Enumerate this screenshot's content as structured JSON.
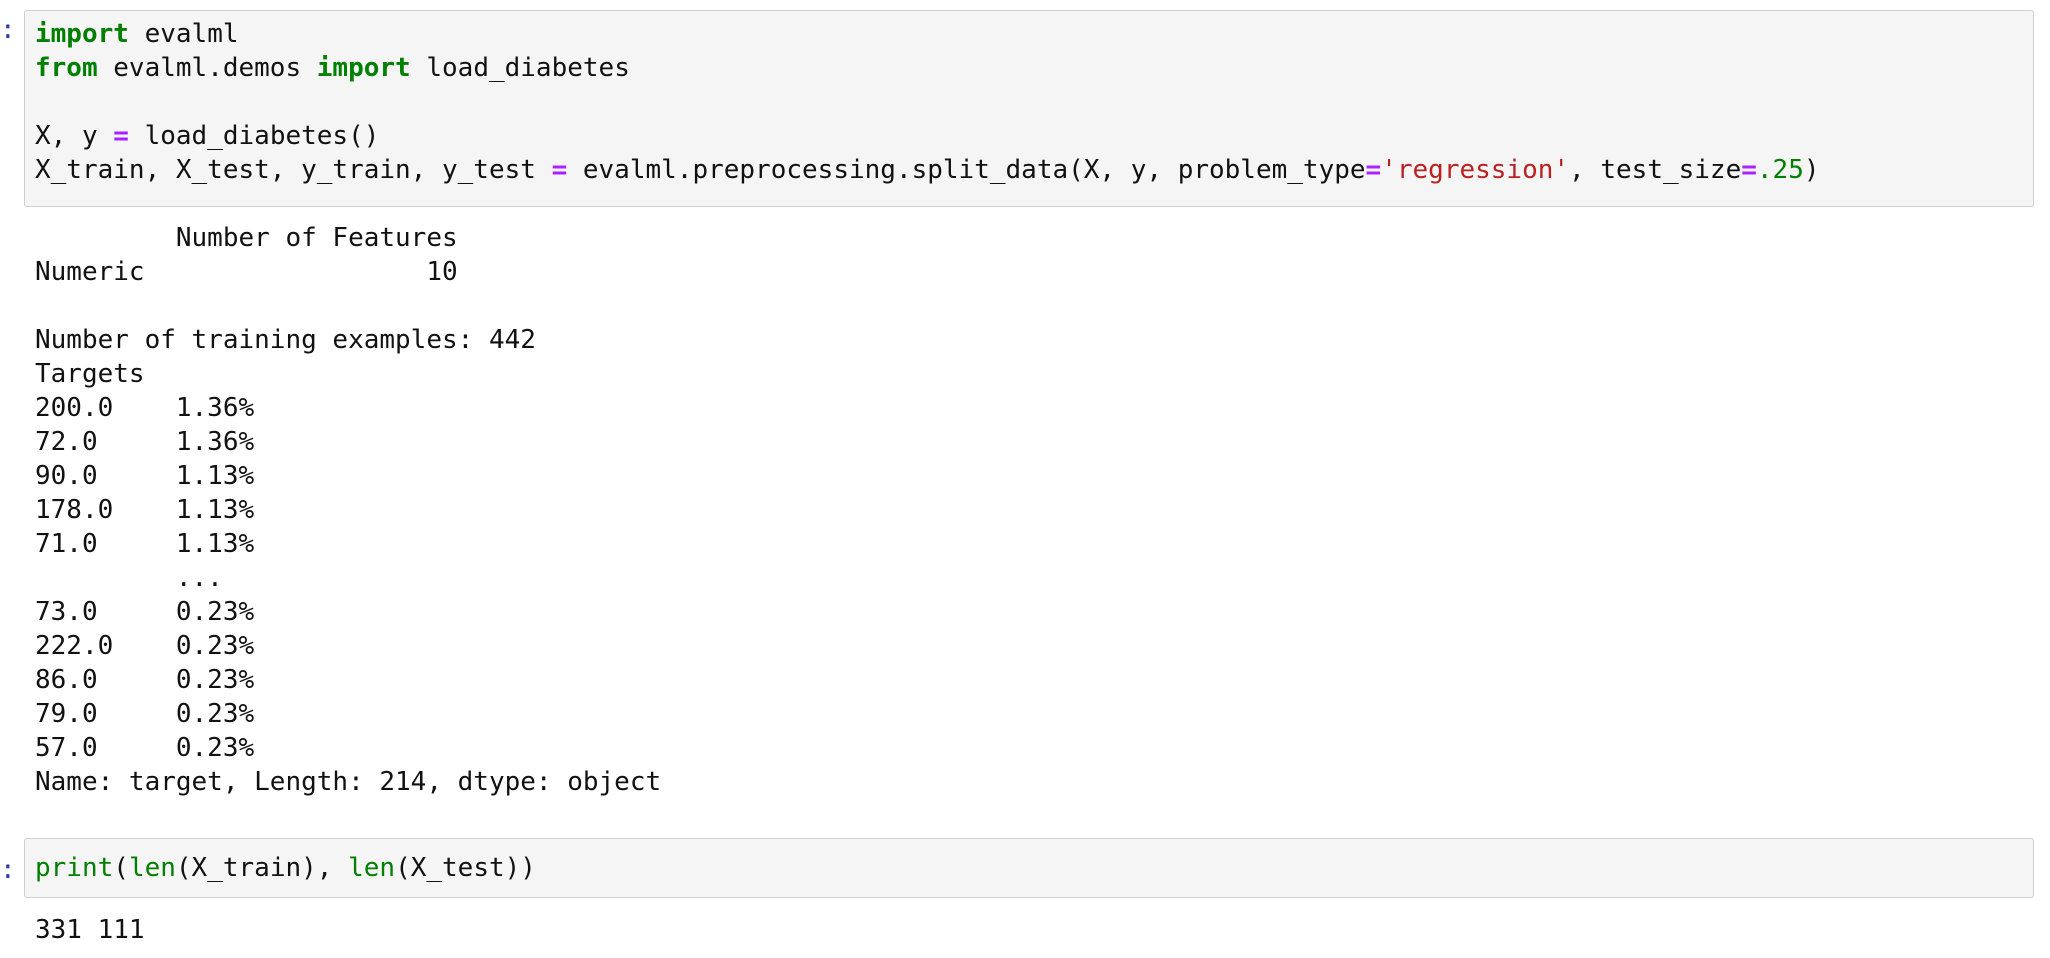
{
  "cell1": {
    "prompt": ":",
    "tokens": {
      "import_kw": "import",
      "module": " evalml",
      "from_kw": "from",
      "submodule": " evalml.demos ",
      "import_kw2": "import",
      "func": " load_diabetes",
      "line3_lhs": "X, y ",
      "eq": "=",
      "line3_rhs": " load_diabetes()",
      "line4_lhs": "X_train, X_test, y_train, y_test ",
      "eq2": "=",
      "line4_call": " evalml.preprocessing.split_data(X, y, problem_type",
      "eq3": "=",
      "str_regression": "'regression'",
      "line4_mid": ", test_size",
      "eq4": "=",
      "num_025": ".25",
      "line4_end": ")"
    }
  },
  "output1": {
    "lines": [
      "         Number of Features",
      "Numeric                  10",
      "",
      "Number of training examples: 442",
      "Targets",
      "200.0    1.36%",
      "72.0     1.36%",
      "90.0     1.13%",
      "178.0    1.13%",
      "71.0     1.13%",
      "         ...",
      "73.0     0.23%",
      "222.0    0.23%",
      "86.0     0.23%",
      "79.0     0.23%",
      "57.0     0.23%",
      "Name: target, Length: 214, dtype: object"
    ]
  },
  "cell2": {
    "prompt": ":",
    "tokens": {
      "print_fn": "print",
      "paren1": "(",
      "len1": "len",
      "arg1": "(X_train), ",
      "len2": "len",
      "arg2": "(X_test))"
    }
  },
  "output2": {
    "text": "331 111"
  },
  "colors": {
    "keyword": "#008000",
    "operator": "#aa22ff",
    "string": "#ba2121",
    "number": "#008000",
    "cell_bg": "#f5f5f5",
    "cell_border": "#cfcfcf"
  }
}
